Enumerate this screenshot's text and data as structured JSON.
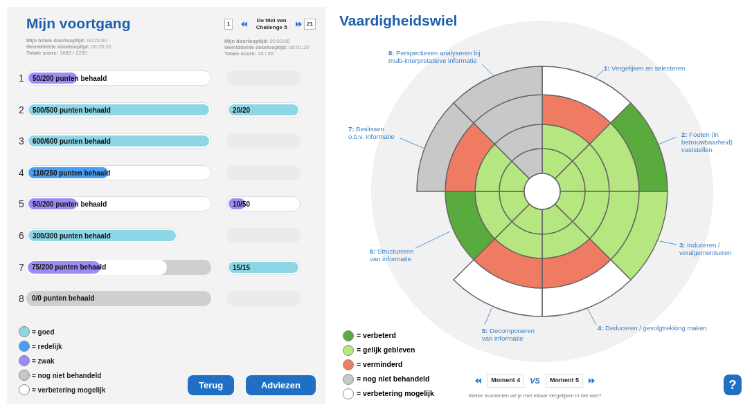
{
  "progress": {
    "title": "Mijn voortgang",
    "stats": [
      "**Mijn totale doorlooptijd:** 00:23:00",
      "**Gemiddelde doorlooptijd:** 00:25:20",
      "**Totale score:** 1685 / 2250"
    ],
    "challenge_nav": {
      "first": "1",
      "title": "De titel van\nChallenge 5",
      "last": "21"
    },
    "challenge_stats": [
      "**Mijn doorlooptijd:** 00:03:00",
      "**Gemiddelde doorlooptijd:** 00:01:20",
      "**Totale score:** 45 / 85"
    ],
    "rows": [
      {
        "number": "1",
        "bar": {
          "text": "50/200 punten behaald",
          "level": 0.28,
          "color": "#9b8cf5",
          "kind": "white"
        }
      },
      {
        "number": "2",
        "bar": {
          "text": "500/500 punten behaald",
          "level": 1,
          "color": "#8dd6e6",
          "kind": "white"
        },
        "challenge": {
          "text": "20/20",
          "level": 1,
          "color": "#8dd6e6",
          "kind": "white"
        }
      },
      {
        "number": "3",
        "bar": {
          "text": "600/600 punten behaald",
          "level": 1,
          "color": "#8dd6e6",
          "kind": "white"
        }
      },
      {
        "number": "4",
        "bar": {
          "text": "110/250 punten behaald",
          "level": 0.45,
          "color": "#4a9ef5",
          "kind": "white"
        }
      },
      {
        "number": "5",
        "bar": {
          "text": "50/200 punten behaald",
          "level": 0.28,
          "color": "#9b8cf5",
          "kind": "white"
        },
        "challenge": {
          "text": "10/50",
          "level": 0.27,
          "color": "#9b8cf5",
          "kind": "white"
        }
      },
      {
        "number": "6",
        "bar": {
          "text": "300/300 punten behaald",
          "level": 1,
          "color": "#8dd6e6",
          "kind": "short"
        }
      },
      {
        "number": "7",
        "bar": {
          "text": "75/200 punten behaald",
          "level": 0.41,
          "color": "#9b8cf5",
          "kind": "grey",
          "potential": {
            "level": 0.76
          }
        },
        "challenge": {
          "text": "15/15",
          "level": 1,
          "color": "#8dd6e6",
          "kind": "white"
        }
      },
      {
        "number": "8",
        "bar": {
          "text": "0/0 punten behaald",
          "kind": "grey"
        }
      }
    ],
    "legend": [
      {
        "color": "#8dd6e6",
        "label": "= goed"
      },
      {
        "color": "#4a9ef5",
        "label": "= redelijk"
      },
      {
        "color": "#9b8cf5",
        "label": "= zwak"
      },
      {
        "color": "#c8c8c8",
        "label": "= nog niet behandeld"
      },
      {
        "color": "#ffffff",
        "label": "= verbetering mogelijk"
      }
    ],
    "buttons": [
      "Terug",
      "Adviezen"
    ]
  },
  "wheel": {
    "title": "Vaardigheidswiel",
    "sectors": [
      {
        "label": "**1:** Vergelijken en selecteren",
        "rings": [
          {
            "color": "#b5e67f"
          },
          {
            "color": "#b5e67f"
          },
          {
            "color": "#ef7c62"
          },
          {
            "color": "#ffffff"
          }
        ]
      },
      {
        "label": "**2:** Fouten (in\nbetrouwbaarheid)\nvaststellen",
        "rings": [
          {
            "color": "#b5e67f"
          },
          {
            "color": "#b5e67f"
          },
          {
            "color": "#b5e67f"
          },
          {
            "color": "#5aab3e"
          }
        ]
      },
      {
        "label": "**3:** Induceren /\nveralgemeniseren",
        "rings": [
          {
            "color": "#b5e67f"
          },
          {
            "color": "#b5e67f"
          },
          {
            "color": "#b5e67f"
          },
          {
            "color": "#b5e67f"
          }
        ]
      },
      {
        "label": "**4:** Deduceren / gevolgtrekking maken",
        "rings": [
          {
            "color": "#b5e67f"
          },
          {
            "color": "#b5e67f"
          },
          {
            "color": "#ef7c62"
          },
          {
            "color": "#ffffff"
          }
        ]
      },
      {
        "label": "**5:** Decomponeren\nvan informatie",
        "rings": [
          {
            "color": "#b5e67f"
          },
          {
            "color": "#b5e67f"
          },
          {
            "color": "#ef7c62"
          },
          {
            "color": "#ffffff"
          }
        ]
      },
      {
        "label": "**6:** Structureren\nvan informatie",
        "rings": [
          {
            "color": "#b5e67f"
          },
          {
            "color": "#b5e67f"
          },
          {
            "color": "#5aab3e"
          }
        ]
      },
      {
        "label": "**7:** Beslissen\no.b.v. informatie",
        "rings": [
          {
            "color": "#b5e67f"
          },
          {
            "color": "#b5e67f"
          },
          {
            "color": "#ef7c62"
          },
          {
            "color": "#c8c8c8"
          }
        ]
      },
      {
        "label": "**8:** Perspectieven analyseren bij\nmulti-interpretatieve informatie",
        "rings": [
          {
            "color": "#c8c8c8"
          },
          {
            "color": "#c8c8c8"
          },
          {
            "color": "#c8c8c8"
          },
          {
            "color": "#c8c8c8"
          }
        ]
      }
    ],
    "legend": [
      {
        "color": "#5aab3e",
        "label": "= verbeterd"
      },
      {
        "color": "#b5e67f",
        "label": "= gelijk gebleven"
      },
      {
        "color": "#ef7c62",
        "label": "= verminderd"
      },
      {
        "color": "#c8c8c8",
        "label": "= nog niet behandeld"
      },
      {
        "color": "#ffffff",
        "label": "= verbetering mogelijk"
      }
    ],
    "compare": {
      "left": "Moment 4",
      "vs": "VS",
      "right": "Moment 5",
      "hint": "Welke momenten wil je met elkaar vergelijken in het wiel?"
    },
    "help": "?"
  }
}
